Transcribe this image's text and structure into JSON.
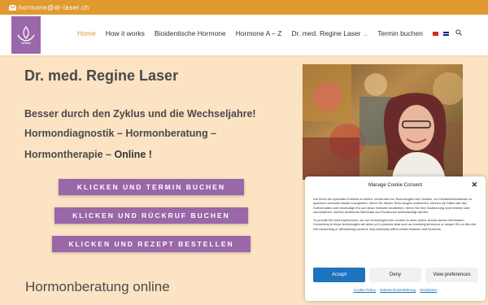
{
  "topbar": {
    "email": "hormone@dr-laser.ch",
    "icon": "mail-icon"
  },
  "nav": {
    "items": [
      {
        "label": "Home"
      },
      {
        "label": "How it works"
      },
      {
        "label": "Bioidentische Hormone"
      },
      {
        "label": "Hormone A – Z"
      },
      {
        "label": "Dr. med. Regine Laser"
      },
      {
        "label": "Termin buchen"
      }
    ],
    "active_index": 0
  },
  "main": {
    "title": "Dr. med. Regine Laser",
    "tagline_1": "Besser durch den Zyklus und die Wechseljahre!",
    "tagline_2": "Hormondiagnostik – Hormonberatung –",
    "tagline_3a": "Hormontherapie  – ",
    "tagline_3b": "Online !",
    "cta_1": "KLICKEN UND TERMIN BUCHEN",
    "cta_2": "KLICKEN UND RÜCKRUF BUCHEN",
    "cta_3": "KLICKEN UND REZEPT BESTELLEN",
    "section_heading": "Hormonberatung online"
  },
  "cookie": {
    "title": "Manage Cookie Consent",
    "body_1": "Um Ihnen ein optimales Erlebnis zu bieten, verwenden wir Technologien wie Cookies, um Geräteinformationen zu speichern und/oder darauf zuzugreifen. Wenn Sie diesen Technologien zustimmen, können wir Daten wie das Surfverhalten oder eindeutige IDs auf dieser Website verarbeiten. Wenn Sie Ihre Zustimmung nicht erteilen oder zurückziehen, können bestimmte Merkmale und Funktionen beeinträchtigt werden.",
    "body_2": "To provide the best experiences, we use technologies like cookies to store and/or access device information. Consenting to these technologies will allow us to process data such as browsing behaviour or unique IDs on this site. Not consenting or withdrawing consent, may adversely affect certain features and functions.",
    "accept": "Accept",
    "deny": "Deny",
    "preferences": "View preferences",
    "links": [
      "Cookie Policy",
      "Datenschutzerklärung",
      "Disclaimer"
    ]
  },
  "colors": {
    "accent": "#e09a2f",
    "purple": "#9a68a8",
    "background": "#fbe3c4",
    "button_blue": "#1e73be"
  }
}
